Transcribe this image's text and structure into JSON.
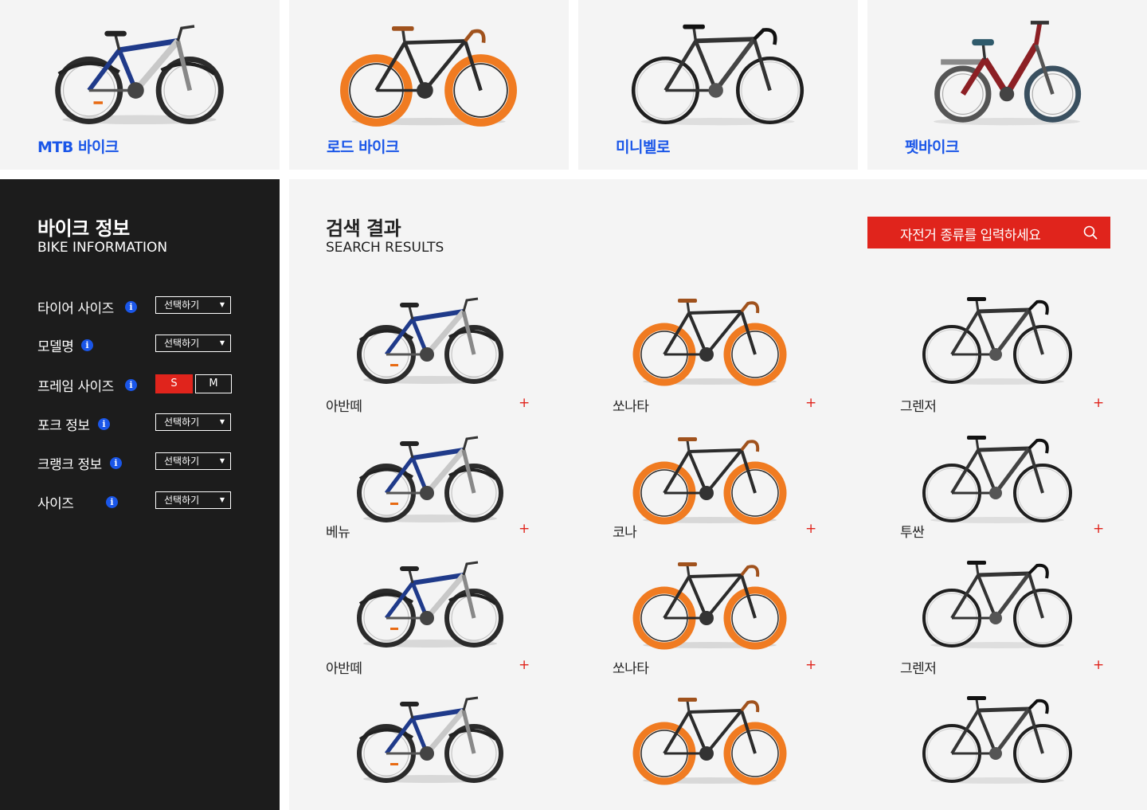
{
  "categories": [
    {
      "label": "MTB 바이크",
      "icon": "mtb-bike-icon"
    },
    {
      "label": "로드 바이크",
      "icon": "road-bike-icon"
    },
    {
      "label": "미니벨로",
      "icon": "minivelo-bike-icon"
    },
    {
      "label": "펫바이크",
      "icon": "folding-bike-icon"
    }
  ],
  "sidebar": {
    "title": "바이크 정보",
    "subtitle": "BIKE INFORMATION",
    "filters": [
      {
        "label": "타이어 사이즈",
        "select": "선택하기"
      },
      {
        "label": "모델명",
        "select": "선택하기"
      },
      {
        "label": "프레임 사이즈",
        "sizes": [
          "S",
          "M"
        ],
        "selected": "S"
      },
      {
        "label": "포크 정보",
        "select": "선택하기"
      },
      {
        "label": "크랭크 정보",
        "select": "선택하기"
      },
      {
        "label": "사이즈",
        "select": "선택하기"
      }
    ],
    "info_glyph": "i",
    "caret": "▼"
  },
  "main": {
    "title": "검색 결과",
    "subtitle": "SEARCH RESULTS",
    "search_placeholder": "자전거 종류를 입력하세요",
    "plus": "+",
    "results": [
      {
        "name": "아반떼",
        "type": "mtb"
      },
      {
        "name": "쏘나타",
        "type": "road"
      },
      {
        "name": "그렌저",
        "type": "black"
      },
      {
        "name": "베뉴",
        "type": "mtb"
      },
      {
        "name": "코나",
        "type": "road"
      },
      {
        "name": "투싼",
        "type": "black"
      },
      {
        "name": "아반떼",
        "type": "mtb"
      },
      {
        "name": "쏘나타",
        "type": "road"
      },
      {
        "name": "그렌저",
        "type": "black"
      },
      {
        "name": "",
        "type": "mtb"
      },
      {
        "name": "",
        "type": "road"
      },
      {
        "name": "",
        "type": "black"
      }
    ]
  },
  "colors": {
    "accent_red": "#e0241c",
    "link_blue": "#1a56e8",
    "sidebar_bg": "#1c1c1c",
    "panel_bg": "#f4f4f4"
  }
}
